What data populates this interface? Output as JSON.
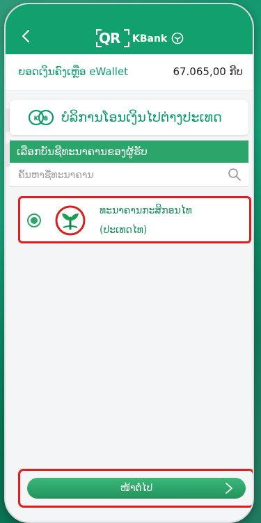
{
  "header": {
    "logo_qr": "QR",
    "logo_kbank": "KBank"
  },
  "balance": {
    "label": "ຍອດເງິນຄົງເຫຼືອ eWallet",
    "value": "67.065,00 ກີບ"
  },
  "service": {
    "title": "ບໍລິການໂອນເງິນໄປຕ່າງປະເທດ",
    "icon_badge": "KB"
  },
  "section": {
    "title": "ເລືອກບັນຊີທະນາຄານຂອງຜູ້ຮັບ"
  },
  "search": {
    "placeholder": "ຄົ້ນຫາຊື່ທະນາຄານ"
  },
  "banks": [
    {
      "name_line1": "ທະນາຄານກະສິກອນໄທ",
      "name_line2": "(ປະເທດໄທ)",
      "selected": true
    }
  ],
  "footer": {
    "next_label": "ໜ້າຕໍ່ໄປ"
  },
  "colors": {
    "brand_green": "#12a06e",
    "section_green": "#2ca56a",
    "highlight_red": "#e21b1b",
    "text_green": "#0f9a6a"
  },
  "icons": {
    "back": "chevron-left-icon",
    "search": "search-icon",
    "next": "chevron-right-icon",
    "bank_logo": "kasikorn-logo-icon",
    "service": "exchange-icon"
  }
}
